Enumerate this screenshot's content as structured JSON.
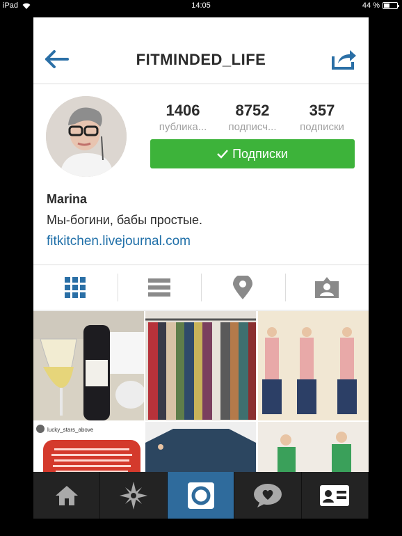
{
  "status_bar": {
    "device": "iPad",
    "time": "14:05",
    "battery": "44 %",
    "battery_level": 0.44
  },
  "header": {
    "title": "FITMINDED_LIFE",
    "back_icon": "back-arrow-icon",
    "share_icon": "share-icon"
  },
  "profile": {
    "stats": [
      {
        "value": "1406",
        "label": "публика..."
      },
      {
        "value": "8752",
        "label": "подписч..."
      },
      {
        "value": "357",
        "label": "подписки"
      }
    ],
    "follow_button": {
      "label": "Подписки",
      "color": "#3db33a"
    },
    "name": "Marina",
    "bio": "Мы-богини, бабы простые.",
    "link": "fitkitchen.livejournal.com"
  },
  "view_tabs": [
    {
      "icon": "grid-icon",
      "active": true
    },
    {
      "icon": "list-icon",
      "active": false
    },
    {
      "icon": "location-pin-icon",
      "active": false
    },
    {
      "icon": "tagged-person-icon",
      "active": false
    }
  ],
  "grid_post": {
    "username": "lucky_stars_above"
  },
  "bottom_tabs": [
    {
      "icon": "home-icon",
      "active": false
    },
    {
      "icon": "explore-star-icon",
      "active": false
    },
    {
      "icon": "camera-icon",
      "active": true
    },
    {
      "icon": "activity-heart-icon",
      "active": false
    },
    {
      "icon": "profile-card-icon",
      "active": false
    }
  ],
  "colors": {
    "accent": "#1f6fa8",
    "active_tab": "#2f6b9c",
    "follow": "#3db33a"
  }
}
